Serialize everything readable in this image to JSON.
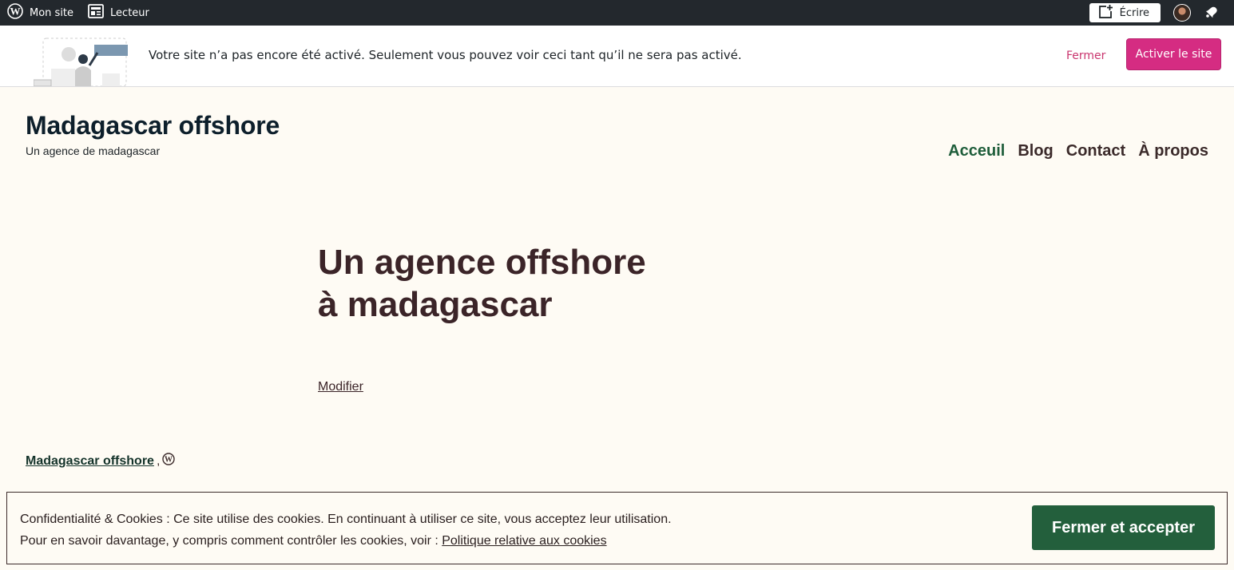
{
  "adminbar": {
    "my_site": "Mon site",
    "reader": "Lecteur",
    "write": "Écrire"
  },
  "notice": {
    "message": "Votre site n’a pas encore été activé. Seulement vous pouvez voir ceci tant qu’il ne sera pas activé.",
    "close": "Fermer",
    "activate": "Activer le site"
  },
  "site": {
    "title": "Madagascar offshore",
    "description": "Un agence de madagascar"
  },
  "nav": {
    "items": [
      "Acceuil",
      "Blog",
      "Contact",
      "À propos"
    ]
  },
  "main": {
    "heading_line1": "Un agence offshore",
    "heading_line2": "à madagascar",
    "edit": "Modifier"
  },
  "footer": {
    "site_link": "Madagascar offshore",
    "separator": ","
  },
  "cookie": {
    "line1": "Confidentialité & Cookies : Ce site utilise des cookies. En continuant à utiliser ce site, vous acceptez leur utilisation.",
    "line2_prefix": "Pour en savoir davantage, y compris comment contrôler les cookies, voir : ",
    "policy_link": "Politique relative aux cookies",
    "accept": "Fermer et accepter"
  },
  "colors": {
    "adminbar_bg": "#23282d",
    "accent_pink": "#d52c82",
    "nav_current": "#1e5d3a",
    "accept_button": "#235f3c",
    "page_bg": "#fefbf4"
  },
  "icons": [
    "wordpress-icon",
    "reader-icon",
    "write-icon",
    "avatar",
    "notifications-bell-icon",
    "wordpress-footer-icon"
  ]
}
